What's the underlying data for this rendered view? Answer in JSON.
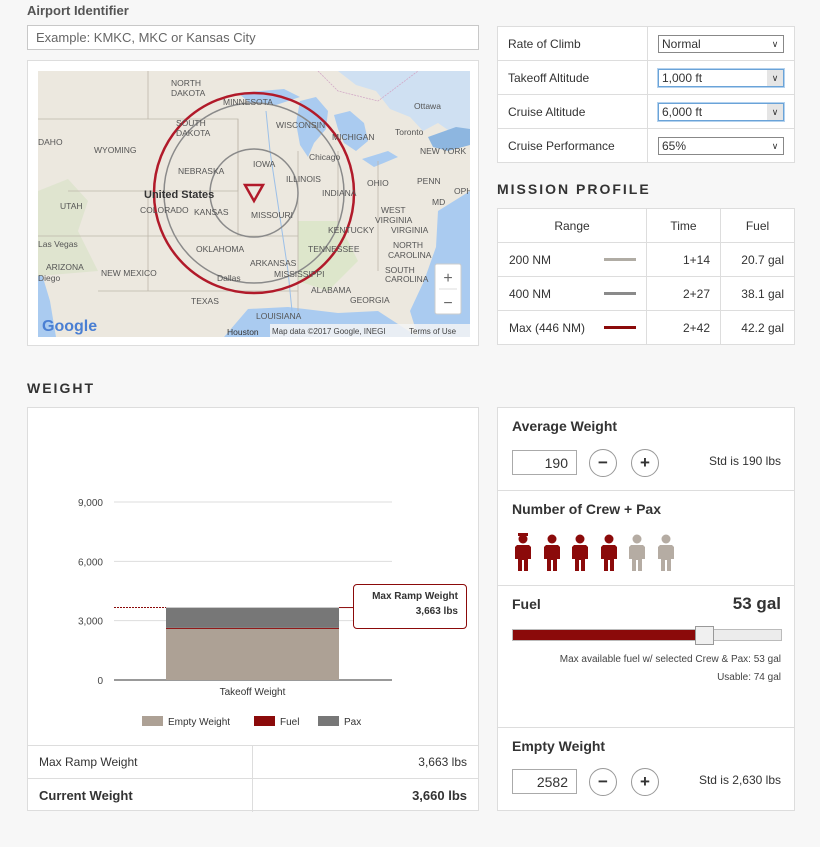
{
  "airport": {
    "label": "Airport Identifier",
    "placeholder": "Example: KMKC, MKC or Kansas City"
  },
  "map": {
    "labels": {
      "north_dakota_1": "NORTH",
      "north_dakota_2": "DAKOTA",
      "minnesota": "MINNESOTA",
      "south_dakota_1": "SOUTH",
      "south_dakota_2": "DAKOTA",
      "wisconsin": "WISCONSIN",
      "michigan": "MICHIGAN",
      "ottawa": "Ottawa",
      "toronto": "Toronto",
      "new_york": "NEW YORK",
      "idaho": "DAHO",
      "wyoming": "WYOMING",
      "nebraska": "NEBRASKA",
      "iowa": "IOWA",
      "chicago": "Chicago",
      "illinois": "ILLINOIS",
      "indiana": "INDIANA",
      "ohio": "OHIO",
      "penn": "PENN",
      "oph": "OPH",
      "united_states": "United States",
      "utah": "UTAH",
      "colorado": "COLORADO",
      "kansas": "KANSAS",
      "missouri": "MISSOURI",
      "west_virginia_1": "WEST",
      "virginia_1": "VIRGINIA",
      "md": "MD",
      "kentucky": "KENTUCKY",
      "virginia_2": "VIRGINIA",
      "las_vegas": "Las Vegas",
      "oklahoma": "OKLAHOMA",
      "tennessee": "TENNESSEE",
      "north_carolina_1": "NORTH",
      "north_carolina_2": "CAROLINA",
      "arizona": "ARIZONA",
      "san_diego": "Diego",
      "new_mexico": "NEW MEXICO",
      "dallas": "Dallas",
      "arkansas": "ARKANSAS",
      "mississippi": "MISSISSIPPI",
      "south_carolina_1": "SOUTH",
      "south_carolina_2": "CAROLINA",
      "alabama": "ALABAMA",
      "texas": "TEXAS",
      "georgia": "GEORGIA",
      "louisiana": "LOUISIANA",
      "houston": "Houston"
    },
    "google_logo": "Google",
    "map_data": "Map data ©2017 Google, INEGI",
    "terms": "Terms of Use",
    "zoom_in": "+",
    "zoom_out": "−",
    "colors": {
      "max_range": "#b11a2a",
      "range_200": "#b0aca4",
      "range_400": "#8a8a8a"
    }
  },
  "performance": {
    "rate_of_climb": {
      "label": "Rate of Climb",
      "value": "Normal"
    },
    "takeoff_altitude": {
      "label": "Takeoff Altitude",
      "value": "1,000 ft"
    },
    "cruise_altitude": {
      "label": "Cruise Altitude",
      "value": "6,000 ft"
    },
    "cruise_performance": {
      "label": "Cruise Performance",
      "value": "65%"
    }
  },
  "mission_profile": {
    "title": "MISSION PROFILE",
    "headers": {
      "range": "Range",
      "time": "Time",
      "fuel": "Fuel"
    },
    "rows": [
      {
        "range": "200 NM",
        "time": "1+14",
        "fuel": "20.7 gal",
        "color": "#b0aca4"
      },
      {
        "range": "400 NM",
        "time": "2+27",
        "fuel": "38.1 gal",
        "color": "#8a8a8a"
      },
      {
        "range": "Max (446 NM)",
        "time": "2+42",
        "fuel": "42.2 gal",
        "color": "#8b0a0a"
      }
    ]
  },
  "weight": {
    "title": "WEIGHT",
    "tooltip": {
      "title": "Max Ramp Weight",
      "value": "3,663 lbs"
    },
    "summary": {
      "max_ramp": {
        "label": "Max Ramp Weight",
        "value": "3,663 lbs"
      },
      "current": {
        "label": "Current Weight",
        "value": "3,660 lbs"
      }
    }
  },
  "chart_data": {
    "type": "bar",
    "categories": [
      "Takeoff Weight"
    ],
    "series": [
      {
        "name": "Empty Weight",
        "values": [
          2582
        ],
        "color": "#ada195"
      },
      {
        "name": "Fuel",
        "values": [
          53
        ],
        "color": "#8b0a0a"
      },
      {
        "name": "Pax",
        "values": [
          1025
        ],
        "color": "#777777"
      }
    ],
    "stacked": true,
    "ylim": [
      0,
      9000
    ],
    "yticks": [
      "0",
      "3,000",
      "6,000",
      "9,000"
    ],
    "max_ramp_line": 3663,
    "legend_position": "bottom",
    "grid": true
  },
  "average_weight": {
    "title": "Average Weight",
    "value": "190",
    "std": "Std is 190 lbs",
    "minus": "−",
    "plus": "+"
  },
  "crew_pax": {
    "title": "Number of Crew + Pax",
    "selected": 4,
    "total": 6,
    "colors": {
      "active": "#8b0a0a",
      "inactive": "#b5aca3"
    }
  },
  "fuel": {
    "title": "Fuel",
    "value": "53 gal",
    "fraction": 0.7162,
    "note1": "Max available fuel w/ selected Crew & Pax: 53 gal",
    "note2": "Usable: 74 gal"
  },
  "empty_weight": {
    "title": "Empty Weight",
    "value": "2582",
    "std": "Std is 2,630 lbs",
    "minus": "−",
    "plus": "+"
  }
}
